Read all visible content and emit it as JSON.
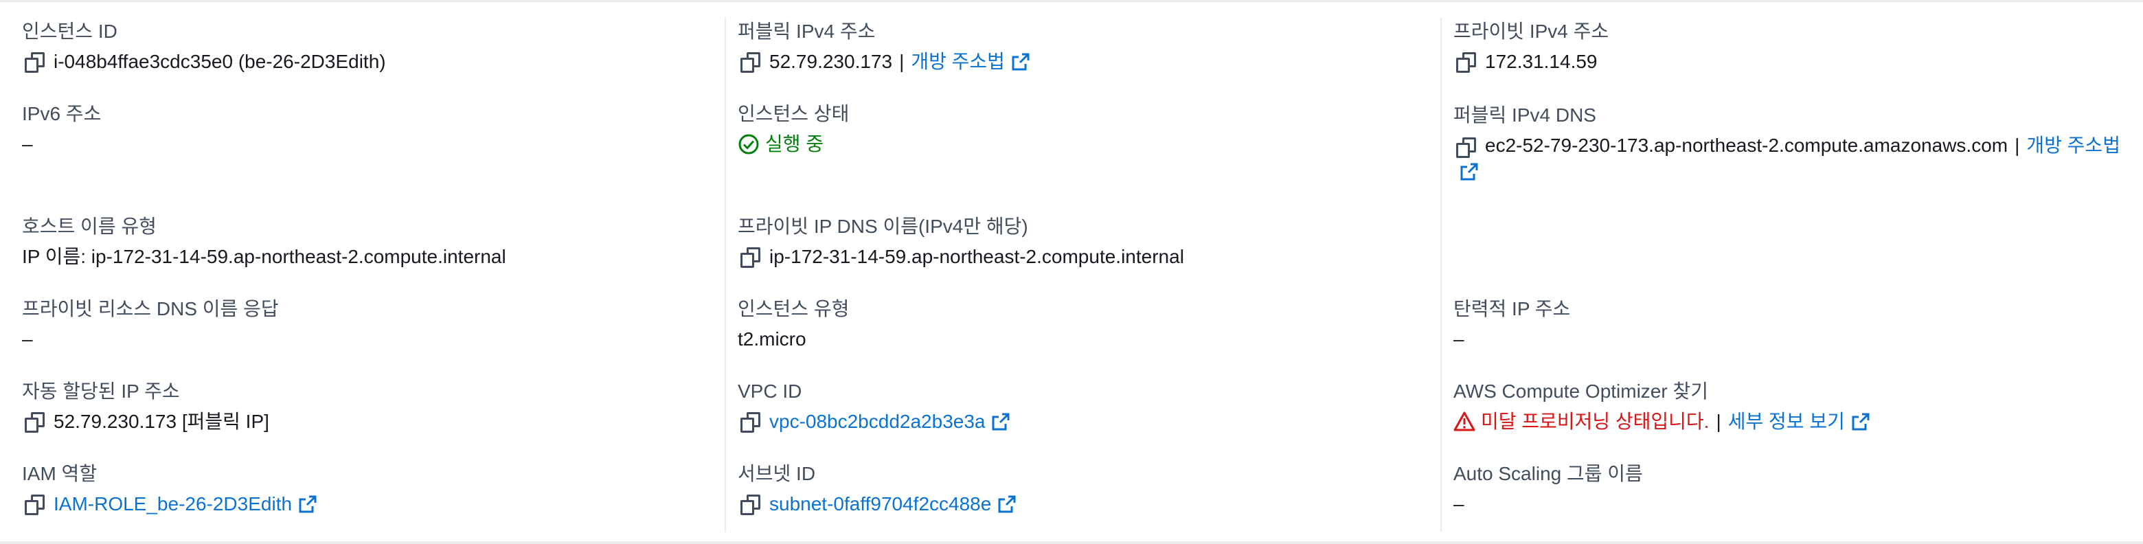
{
  "instance": {
    "col1": {
      "instance_id": {
        "label": "인스턴스 ID",
        "value": "i-048b4ffae3cdc35e0 (be-26-2D3Edith)"
      },
      "ipv6": {
        "label": "IPv6 주소",
        "value": "–"
      },
      "hostname_type": {
        "label": "호스트 이름 유형",
        "value": "IP 이름: ip-172-31-14-59.ap-northeast-2.compute.internal"
      },
      "private_dns_answer": {
        "label": "프라이빗 리소스 DNS 이름 응답",
        "value": "–"
      },
      "auto_ip": {
        "label": "자동 할당된 IP 주소",
        "value": "52.79.230.173 [퍼블릭 IP]"
      },
      "iam_role": {
        "label": "IAM 역할",
        "value": "IAM-ROLE_be-26-2D3Edith"
      }
    },
    "col2": {
      "public_ipv4": {
        "label": "퍼블릭 IPv4 주소",
        "value": "52.79.230.173",
        "sep": "|",
        "link": "개방 주소법"
      },
      "state": {
        "label": "인스턴스 상태",
        "value": "실행 중"
      },
      "private_ip_dns": {
        "label": "프라이빗 IP DNS 이름(IPv4만 해당)",
        "value": "ip-172-31-14-59.ap-northeast-2.compute.internal"
      },
      "instance_type": {
        "label": "인스턴스 유형",
        "value": "t2.micro"
      },
      "vpc_id": {
        "label": "VPC ID",
        "value": "vpc-08bc2bcdd2a2b3e3a"
      },
      "subnet_id": {
        "label": "서브넷 ID",
        "value": "subnet-0faff9704f2cc488e"
      }
    },
    "col3": {
      "private_ipv4": {
        "label": "프라이빗 IPv4 주소",
        "value": "172.31.14.59"
      },
      "public_dns": {
        "label": "퍼블릭 IPv4 DNS",
        "value": "ec2-52-79-230-173.ap-northeast-2.compute.amazonaws.com",
        "sep": "|",
        "link": "개방 주소법"
      },
      "elastic_ip": {
        "label": "탄력적 IP 주소",
        "value": "–"
      },
      "optimizer": {
        "label": "AWS Compute Optimizer 찾기",
        "warning": "미달 프로비저닝 상태입니다.",
        "sep": "|",
        "link": "세부 정보 보기"
      },
      "asg": {
        "label": "Auto Scaling 그룹 이름",
        "value": "–"
      }
    }
  },
  "colors": {
    "link": "#0972d3",
    "success": "#037f0c",
    "error": "#d91515",
    "label": "#414d5c"
  },
  "icons": {
    "copy": "copy-icon",
    "external": "external-link-icon",
    "success": "check-circle-icon",
    "warning": "warning-triangle-icon"
  }
}
